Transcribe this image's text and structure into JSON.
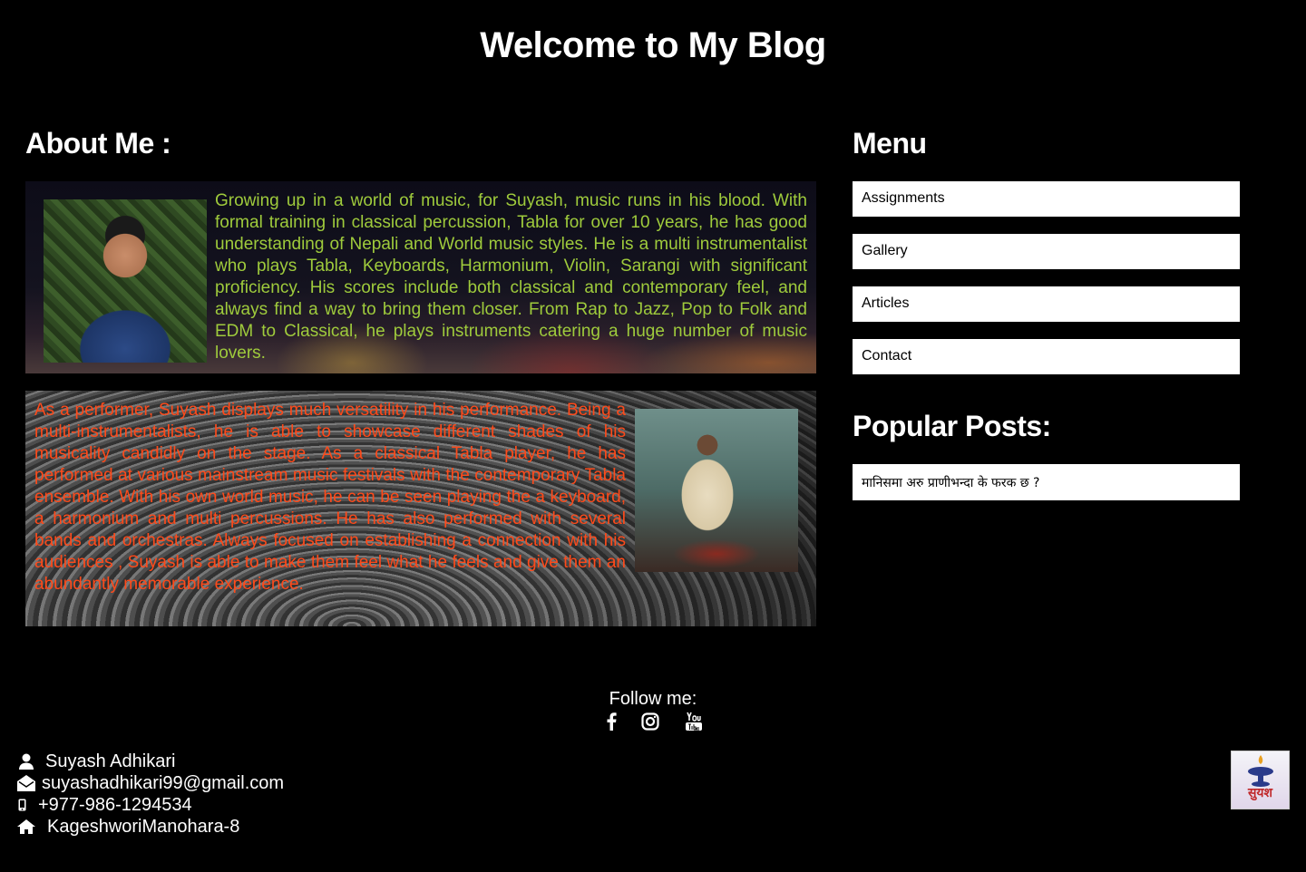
{
  "header": {
    "title": "Welcome to My Blog"
  },
  "about": {
    "heading": "About Me :",
    "paragraph_1": "Growing up in a world of music, for Suyash, music runs in his blood. With formal training in classical percussion, Tabla for over 10 years, he has good understanding of Nepali and World music styles. He is a multi instrumentalist who plays Tabla, Keyboards, Harmonium, Violin, Sarangi with significant proficiency. His scores include both classical and contemporary feel, and always find a way to bring them closer. From Rap to Jazz, Pop to Folk and EDM to Classical, he plays instruments catering a huge number of music lovers.",
    "paragraph_2": "As a performer, Suyash displays much versatility in his performance. Being a multi-instrumentalists, he is able to showcase different shades of his musicality candidly on the stage. As a classical Tabla player, he has performed at various mainstream music festivals with the contemporary Tabla ensemble. With his own world music, he can be seen playing the a keyboard, a harmonium and multi percussions. He has also performed with several bands and orchestras. Always focused on establishing a connection with his audiences , Suyash is able to make them feel what he feels and give them an abundantly memorable experience.",
    "text_color_1": "#9fcb3c",
    "text_color_2": "#ff4a1a"
  },
  "menu": {
    "heading": "Menu",
    "items": [
      "Assignments",
      "Gallery",
      "Articles",
      "Contact"
    ]
  },
  "popular_posts": {
    "heading": "Popular Posts:",
    "items": [
      "मानिसमा अरु प्राणीभन्दा के फरक छ ?"
    ]
  },
  "follow": {
    "label": "Follow me:",
    "icons": [
      "facebook-icon",
      "instagram-icon",
      "youtube-icon"
    ]
  },
  "contact": {
    "name": "Suyash Adhikari",
    "email": "suyashadhikari99@gmail.com",
    "phone": "+977-986-1294534",
    "address": "KageshworiManohara-8"
  },
  "logo": {
    "text": "सुयश"
  }
}
